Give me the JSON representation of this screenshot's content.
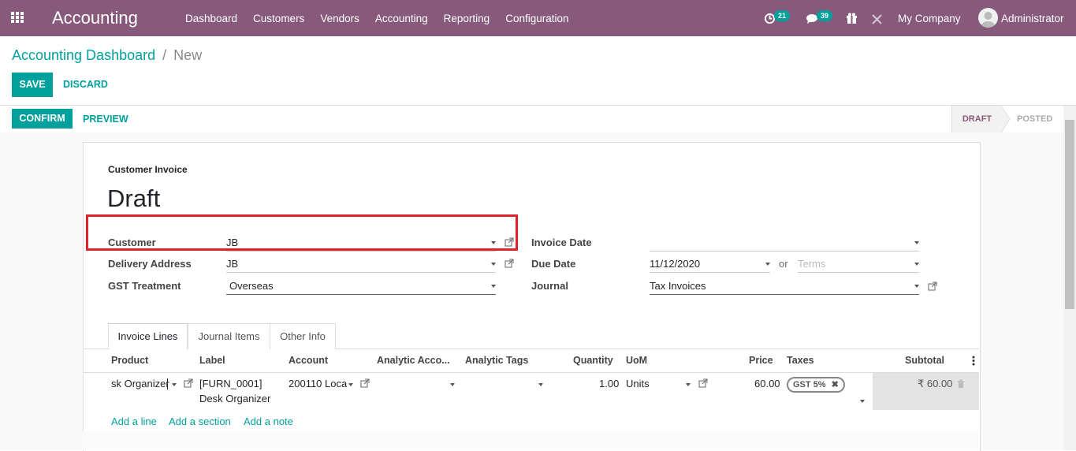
{
  "navbar": {
    "app_title": "Accounting",
    "menu": [
      "Dashboard",
      "Customers",
      "Vendors",
      "Accounting",
      "Reporting",
      "Configuration"
    ],
    "activity_count": "21",
    "messages_count": "39",
    "company": "My Company",
    "user": "Administrator"
  },
  "breadcrumb": {
    "parent": "Accounting Dashboard",
    "separator": "/",
    "current": "New"
  },
  "actions": {
    "save": "SAVE",
    "discard": "DISCARD"
  },
  "statusbar": {
    "confirm": "CONFIRM",
    "preview": "PREVIEW",
    "stages": [
      "DRAFT",
      "POSTED"
    ],
    "active_stage": "DRAFT"
  },
  "invoice": {
    "type_label": "Customer Invoice",
    "state": "Draft",
    "fields": {
      "customer_label": "Customer",
      "customer_value": "JB",
      "delivery_label": "Delivery Address",
      "delivery_value": "JB",
      "gst_label": "GST Treatment",
      "gst_value": "Overseas",
      "invoice_date_label": "Invoice Date",
      "invoice_date_value": "",
      "due_date_label": "Due Date",
      "due_date_value": "11/12/2020",
      "or_label": "or",
      "terms_placeholder": "Terms",
      "journal_label": "Journal",
      "journal_value": "Tax Invoices"
    }
  },
  "tabs": [
    "Invoice Lines",
    "Journal Items",
    "Other Info"
  ],
  "lines_table": {
    "columns": [
      "Product",
      "Label",
      "Account",
      "Analytic Acco...",
      "Analytic Tags",
      "Quantity",
      "UoM",
      "Price",
      "Taxes",
      "Subtotal"
    ],
    "row": {
      "product": "sk Organizer",
      "label_line1": "[FURN_0001]",
      "label_line2": "Desk Organizer",
      "account": "200110 Loca",
      "quantity": "1.00",
      "uom": "Units",
      "price": "60.00",
      "tax_tag": "GST 5%",
      "subtotal": "₹ 60.00"
    },
    "add_links": [
      "Add a line",
      "Add a section",
      "Add a note"
    ]
  },
  "colors": {
    "brand": "#875A7B",
    "accent": "#00A09D",
    "highlight": "#e0232b"
  }
}
